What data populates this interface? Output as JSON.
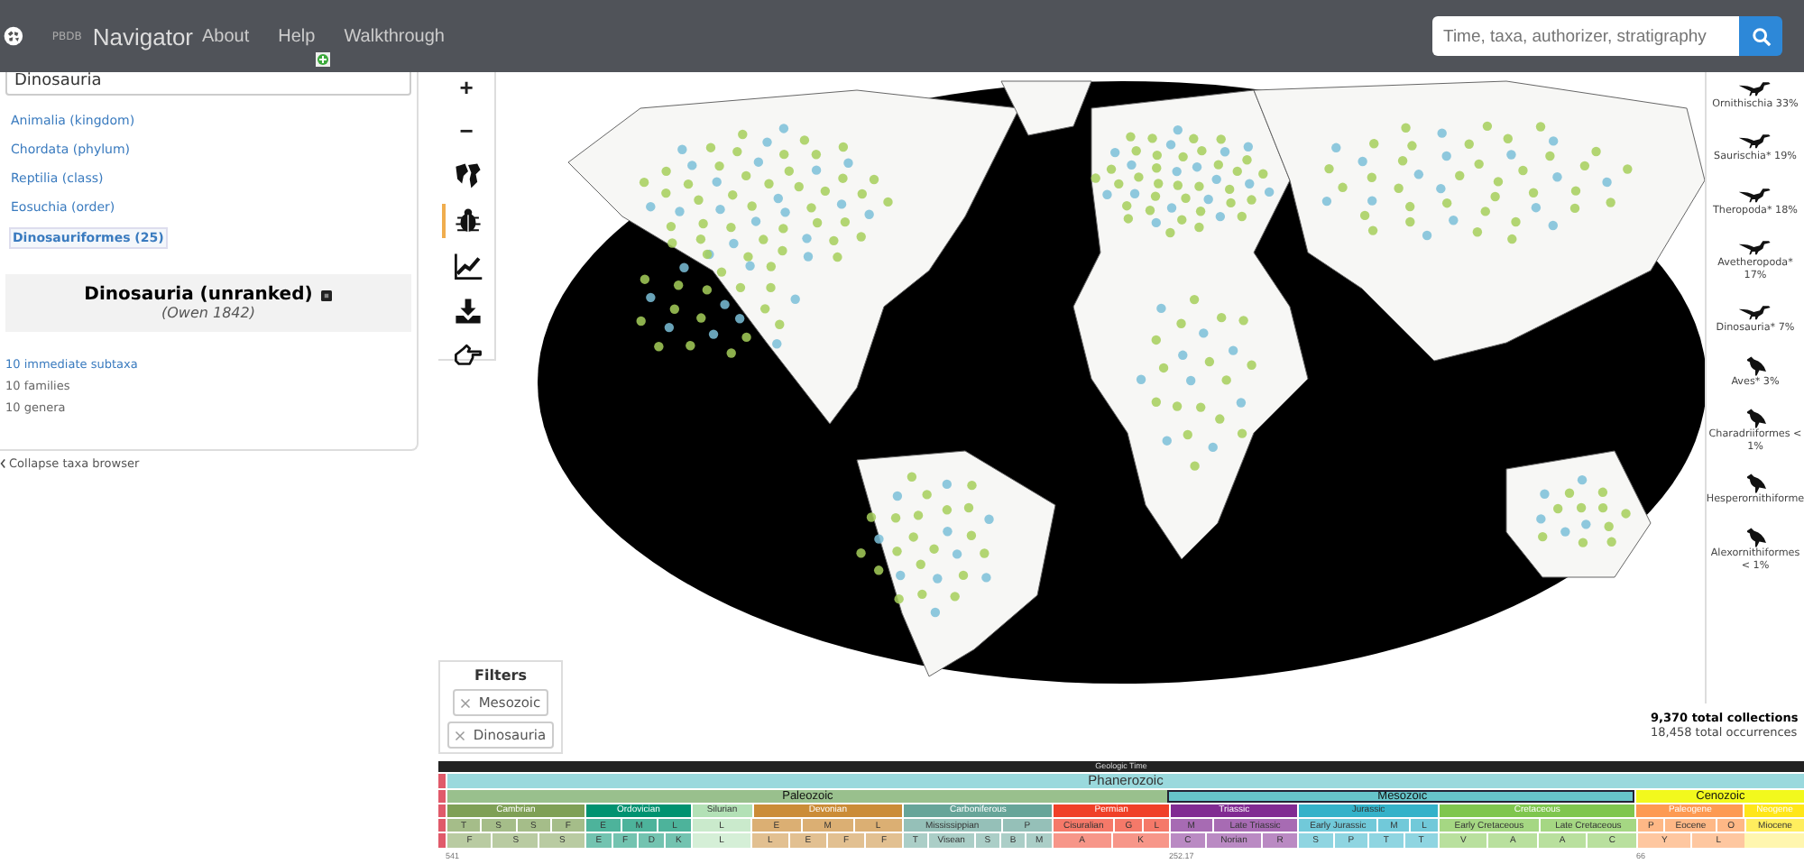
{
  "header": {
    "brand_small": "PBDB",
    "brand": "Navigator",
    "nav": [
      "About",
      "Help",
      "Walkthrough"
    ],
    "search": {
      "placeholder": "Time, taxa, authorizer, stratigraphy"
    }
  },
  "taxa_browser": {
    "search_value": "Dinosauria",
    "hierarchy": [
      {
        "label": "Animalia (kingdom)",
        "selected": false
      },
      {
        "label": "Chordata (phylum)",
        "selected": false
      },
      {
        "label": "Reptilia (class)",
        "selected": false
      },
      {
        "label": "Eosuchia (order)",
        "selected": false
      },
      {
        "label": "Dinosauriformes (25)",
        "selected": true
      }
    ],
    "taxon": {
      "name": "Dinosauria (unranked)",
      "author": "(Owen 1842)"
    },
    "stats": [
      {
        "label": "10 immediate subtaxa",
        "kind": "link"
      },
      {
        "label": "10 families",
        "kind": "text"
      },
      {
        "label": "10 genera",
        "kind": "text"
      }
    ],
    "collapse_label": "Collapse taxa browser"
  },
  "toolbar": {
    "zoom": [
      "+",
      "−"
    ],
    "tools": [
      {
        "kind": "layers",
        "selected": false
      },
      {
        "kind": "bug",
        "selected": true
      },
      {
        "kind": "chart",
        "selected": false
      },
      {
        "kind": "download",
        "selected": false
      },
      {
        "kind": "pointer",
        "selected": false
      }
    ]
  },
  "filters": {
    "title": "Filters",
    "items": [
      "Mesozoic",
      "Dinosauria"
    ]
  },
  "taxa_sidebar": [
    {
      "label": "Ornithischia 33%",
      "kind": "dinosaur"
    },
    {
      "label": "Saurischia* 19%",
      "kind": "dinosaur"
    },
    {
      "label": "Theropoda* 18%",
      "kind": "dinosaur"
    },
    {
      "label": "Avetheropoda* 17%",
      "kind": "dinosaur"
    },
    {
      "label": "Dinosauria* 7%",
      "kind": "dinosaur"
    },
    {
      "label": "Aves* 3%",
      "kind": "bird"
    },
    {
      "label": "Charadriiformes < 1%",
      "kind": "bird"
    },
    {
      "label": "Hesperornithiforme",
      "kind": "bird"
    },
    {
      "label": "Alexornithiformes < 1%",
      "kind": "bird"
    }
  ],
  "summary": {
    "collections": "9,370 total collections",
    "occurrences": "18,458 total occurrences"
  },
  "timescale": {
    "title": "Geologic Time",
    "eon": {
      "label": "Phanerozoic",
      "color": "#9ad9dd"
    },
    "eras": [
      {
        "label": "Paleozoic",
        "color": "#99c08d",
        "selected": false
      },
      {
        "label": "Mesozoic",
        "color": "#67c5ca",
        "selected": true
      },
      {
        "label": "Cenozoic",
        "color": "#f2f91d",
        "selected": false
      }
    ],
    "periods": [
      {
        "label": "Cambrian",
        "color": "#7fa056",
        "epochs": [
          "T",
          "S",
          "S",
          "F"
        ],
        "ages": [
          "F",
          "S",
          "S"
        ]
      },
      {
        "label": "Ordovician",
        "color": "#009270",
        "epochs": [
          "E",
          "M",
          "L"
        ],
        "ages": [
          "E",
          "F",
          "D",
          "K"
        ]
      },
      {
        "label": "Silurian",
        "color": "#b3e1b6",
        "epochs": [
          "L"
        ],
        "ages": [
          "L"
        ]
      },
      {
        "label": "Devonian",
        "color": "#cb8c37",
        "epochs": [
          "E",
          "M",
          "L"
        ],
        "ages": [
          "L",
          "E",
          "F",
          "F"
        ]
      },
      {
        "label": "Carboniferous",
        "color": "#67a599",
        "epochs": [
          "Mississippian",
          "P"
        ],
        "ages": [
          "T",
          "Visean",
          "S",
          "B",
          "M"
        ]
      },
      {
        "label": "Permian",
        "color": "#f04028",
        "epochs": [
          "Cisuralian",
          "G",
          "L"
        ],
        "ages": [
          "A",
          "K"
        ]
      },
      {
        "label": "Triassic",
        "color": "#812b92",
        "epochs": [
          "M",
          "Late Triassic"
        ],
        "ages": [
          "C",
          "Norian",
          "R"
        ]
      },
      {
        "label": "Jurassic",
        "color": "#34b2c9",
        "epochs": [
          "Early Jurassic",
          "M",
          "L"
        ],
        "ages": [
          "S",
          "P",
          "T",
          "T"
        ]
      },
      {
        "label": "Cretaceous",
        "color": "#7fc64e",
        "epochs": [
          "Early Cretaceous",
          "Late Cretaceous"
        ],
        "ages": [
          "V",
          "A",
          "A",
          "C"
        ]
      },
      {
        "label": "Paleogene",
        "color": "#fd9a52",
        "epochs": [
          "P",
          "Eocene",
          "O"
        ],
        "ages": [
          "Y",
          "L"
        ]
      },
      {
        "label": "Neogene",
        "color": "#ffe619",
        "epochs": [
          "Miocene"
        ]
      }
    ],
    "ticks": [
      "541",
      "252.17",
      "66"
    ]
  }
}
